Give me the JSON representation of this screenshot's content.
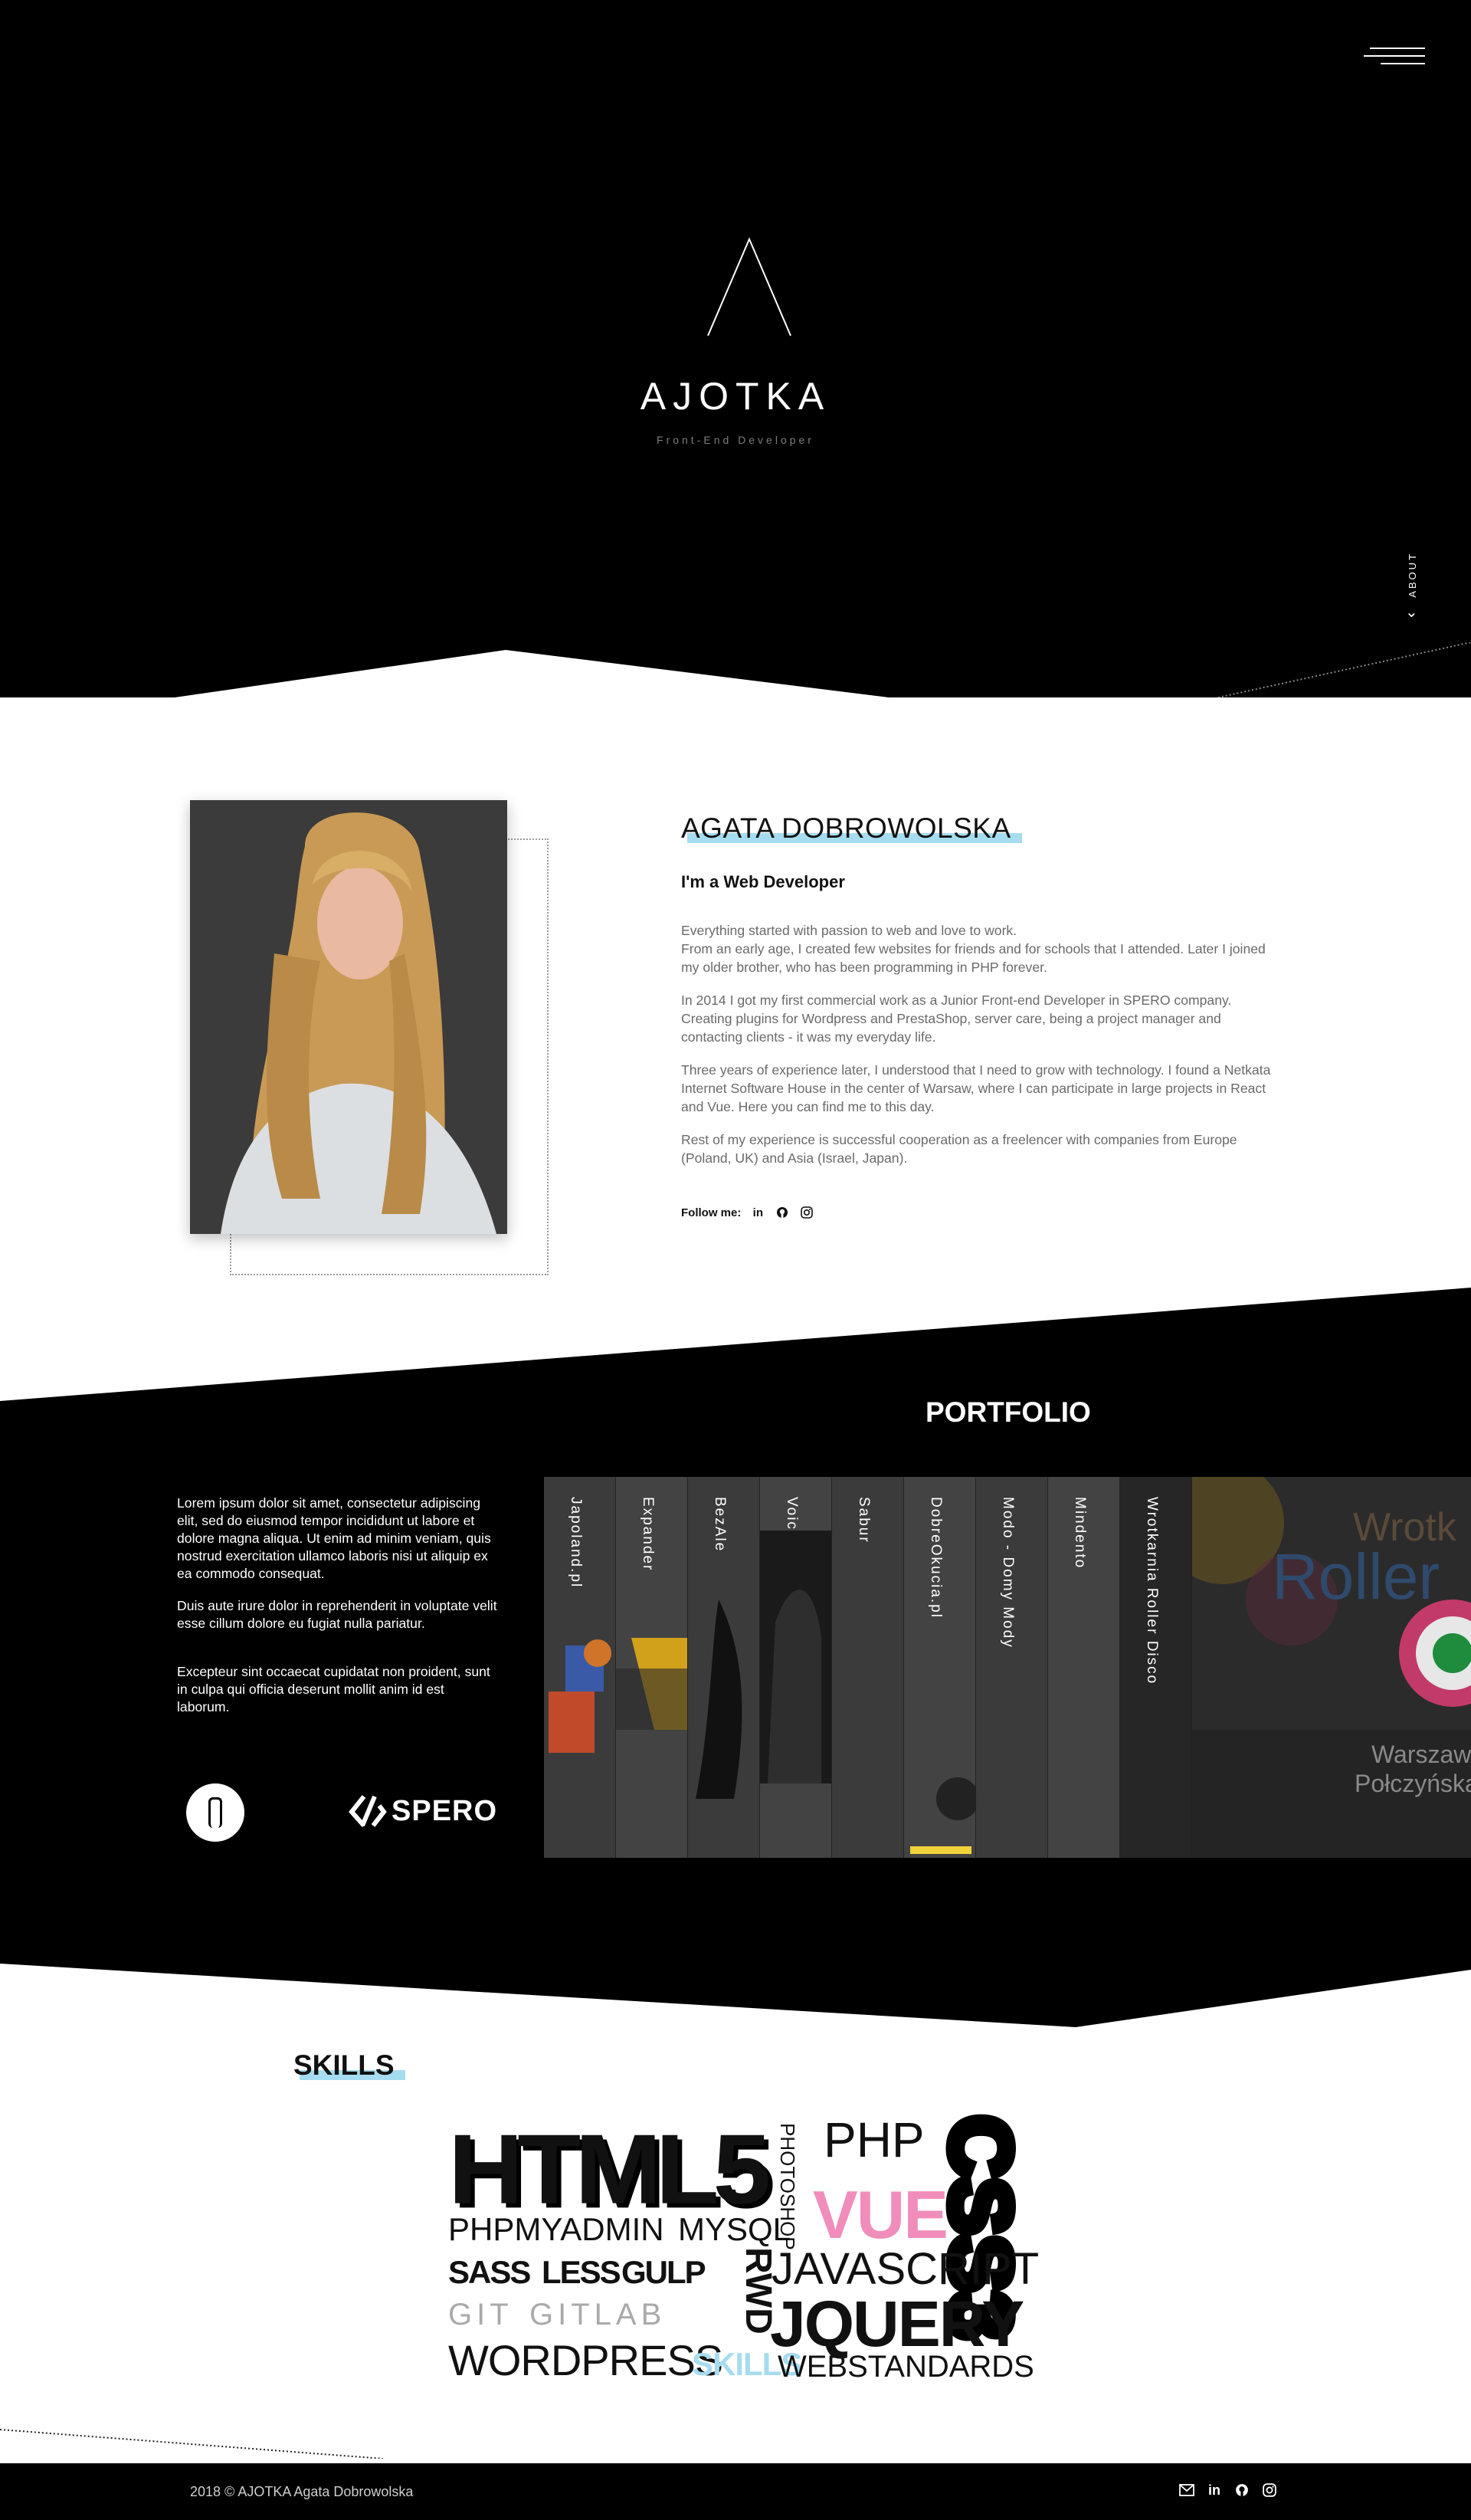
{
  "hero": {
    "title": "AJOTKA",
    "subtitle": "Front-End Developer",
    "about_label": "ABOUT",
    "menu_icon": "hamburger-icon",
    "scroll_icon": "chevron-down-icon"
  },
  "about": {
    "name": "AGATA DOBROWOLSKA",
    "role": "I'm a Web Developer",
    "paragraphs": [
      "Everything started with passion to web and love to work.\nFrom an early age, I created few websites for friends and for schools that I attended. Later I joined my older brother, who has been programming in PHP forever.",
      "In 2014 I got my first commercial work as a Junior Front-end Developer in SPERO company. Creating plugins for Wordpress and PrestaShop, server care, being a project manager and contacting clients - it was my everyday life.",
      "Three years of experience later, I understood that I need to grow with technology. I found a Netkata Internet Software House in the center of Warsaw, where I can participate in large projects in React and Vue. Here you can find me to this day.",
      "Rest of my experience is successful cooperation as a freelencer with companies from Europe (Poland, UK) and Asia (Israel, Japan)."
    ],
    "follow_label": "Follow me:",
    "social_icons": [
      "linkedin-icon",
      "github-icon",
      "instagram-icon"
    ]
  },
  "portfolio": {
    "title": "PORTFOLIO",
    "paragraphs": [
      "Lorem ipsum dolor sit amet, consectetur adipiscing elit, sed do eiusmod tempor incididunt ut labore et dolore magna aliqua. Ut enim ad minim veniam, quis nostrud exercitation ullamco laboris nisi ut aliquip ex ea commodo consequat.",
      "Duis aute irure dolor in reprehenderit in voluptate velit esse cillum dolore eu fugiat nulla pariatur.",
      "Excepteur sint occaecat cupidatat non proident, sunt in culpa qui officia deserunt mollit anim id est laborum."
    ],
    "brand_name": "SPERO",
    "projects": [
      "Japoland.pl",
      "Expander",
      "BezAle",
      "VoiceFlow",
      "Sabur",
      "DobreOkucia.pl",
      "Modo - Domy Mody",
      "Mindento",
      "Wrotkarnia Roller Disco"
    ],
    "featured": {
      "line1": "Wrotk",
      "line2": "Roller",
      "line3": "Warszaw",
      "line4": "Połczyńska"
    }
  },
  "skills": {
    "title": "SKILLS",
    "cloud": {
      "html5": "HTML5",
      "photoshop": "PHOTOSHOP",
      "php": "PHP",
      "css3": "CSS3",
      "phpmyadmin": "PHPMYADMIN",
      "mysql": "MYSQL",
      "vue": "VUE",
      "sass": "SASS",
      "less": "LESS",
      "gulp": "GULP",
      "rwd": "RWD",
      "javascript": "JAVASCRIPT",
      "git": "GIT",
      "gitlab": "GITLAB",
      "jquery": "JQUERY",
      "wordpress": "WORDPRESS",
      "skills": "SKILLS",
      "webstandards": "WEBSTANDARDS"
    },
    "accent_blue": "#a6dcef",
    "accent_pink": "#f08dbb"
  },
  "footer": {
    "copyright": "2018 © AJOTKA Agata Dobrowolska",
    "icons": [
      "mail-icon",
      "linkedin-icon",
      "github-icon",
      "instagram-icon"
    ]
  }
}
